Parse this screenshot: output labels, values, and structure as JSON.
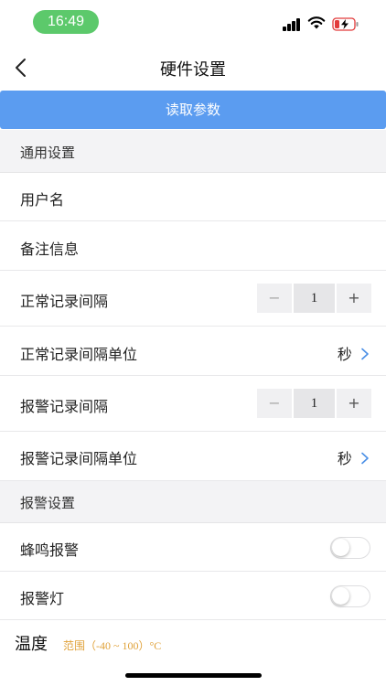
{
  "status_bar": {
    "time": "16:49"
  },
  "nav": {
    "title": "硬件设置"
  },
  "read_button": {
    "label": "读取参数"
  },
  "sections": {
    "general": "通用设置",
    "alarm": "报警设置"
  },
  "fields": {
    "username": "用户名",
    "remark": "备注信息",
    "normal_interval": {
      "label": "正常记录间隔",
      "value": "1",
      "minus": "−",
      "plus": "+"
    },
    "normal_interval_unit": {
      "label": "正常记录间隔单位",
      "value": "秒"
    },
    "alarm_interval": {
      "label": "报警记录间隔",
      "value": "1",
      "minus": "−",
      "plus": "+"
    },
    "alarm_interval_unit": {
      "label": "报警记录间隔单位",
      "value": "秒"
    },
    "buzzer_alarm": {
      "label": "蜂鸣报警",
      "on": false
    },
    "alarm_light": {
      "label": "报警灯",
      "on": false
    }
  },
  "temperature": {
    "label": "温度",
    "range": "范围（-40 ~ 100）°C"
  },
  "colors": {
    "accent": "#5b9cf0",
    "time_pill": "#5cc96b",
    "range_text": "#e0a23a",
    "section_bg": "#f3f3f5"
  },
  "icons": [
    "back-chevron-icon",
    "cellular-signal-icon",
    "wifi-icon",
    "battery-charging-icon",
    "chevron-right-icon"
  ]
}
